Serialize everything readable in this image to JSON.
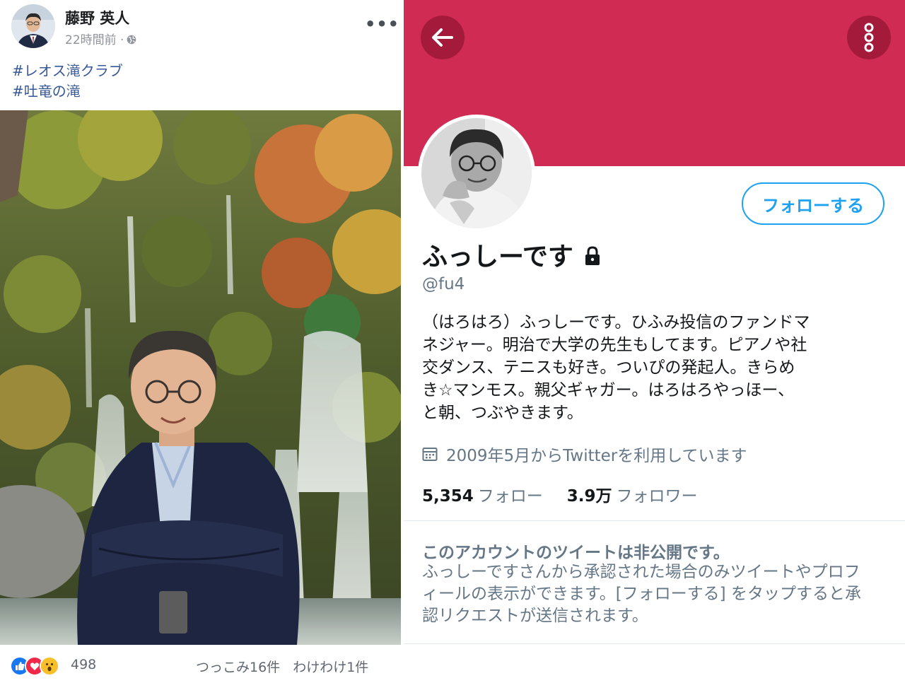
{
  "facebook_post": {
    "author_name": "藤野 英人",
    "time_label": "22時間前 ·",
    "privacy_icon": "globe-icon",
    "more_label": "•••",
    "hashtags": [
      "#レオス滝クラブ",
      "#吐竜の滝"
    ],
    "reactions": {
      "icons": [
        "like-icon",
        "love-icon",
        "wow-icon"
      ],
      "count": "498"
    },
    "comments_label": "つっこみ16件",
    "shares_label": "わけわけ1件"
  },
  "twitter_profile": {
    "banner_color": "#d02b52",
    "follow_button_label": "フォローする",
    "display_name": "ふっしーです",
    "handle": "@fu4",
    "bio_lines": [
      "（はろはろ）ふっしーです。ひふみ投信のファンドマ",
      "ネジャー。明治で大学の先生もしてます。ピアノや社",
      "交ダンス、テニスも好き。ついぴの発起人。きらめ",
      "き☆マンモス。親父ギャガー。はろはろやっほー、",
      "と朝、つぶやきます。"
    ],
    "joined_text": "2009年5月からTwitterを利用しています",
    "following_count": "5,354",
    "following_label": "フォロー",
    "followers_count": "3.9万",
    "followers_label": "フォロワー",
    "protected_title": "このアカウントのツイートは非公開です。",
    "protected_lines": [
      "ふっしーですさんから承認された場合のみツイートやプロフ",
      "ィールの表示ができます。[フォローする] をタップすると承",
      "認リクエストが送信されます。"
    ]
  }
}
